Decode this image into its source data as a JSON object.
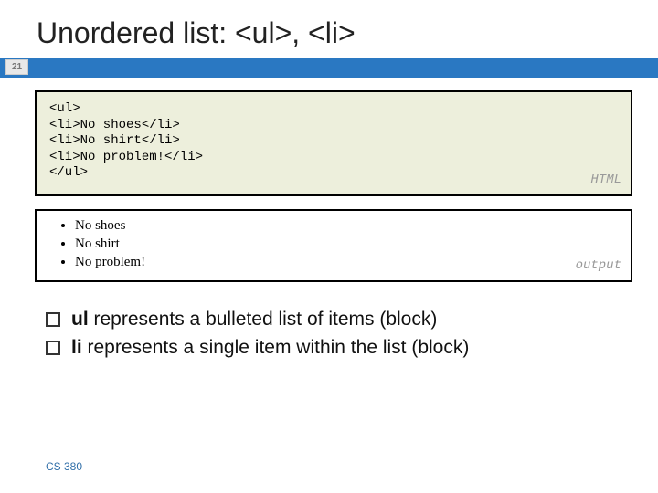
{
  "title": "Unordered list: <ul>, <li>",
  "pageNumber": "21",
  "codeBox": {
    "content": "<ul>\n<li>No shoes</li>\n<li>No shirt</li>\n<li>No problem!</li>\n</ul>",
    "label": "HTML"
  },
  "outputBox": {
    "items": [
      "No shoes",
      "No shirt",
      "No problem!"
    ],
    "label": "output"
  },
  "notes": {
    "line1_prefix": "ul",
    "line1_rest": " represents a bulleted list of items (block)",
    "line2_prefix": "li",
    "line2_rest": " represents a single item within the list (block)"
  },
  "footer": "CS 380"
}
